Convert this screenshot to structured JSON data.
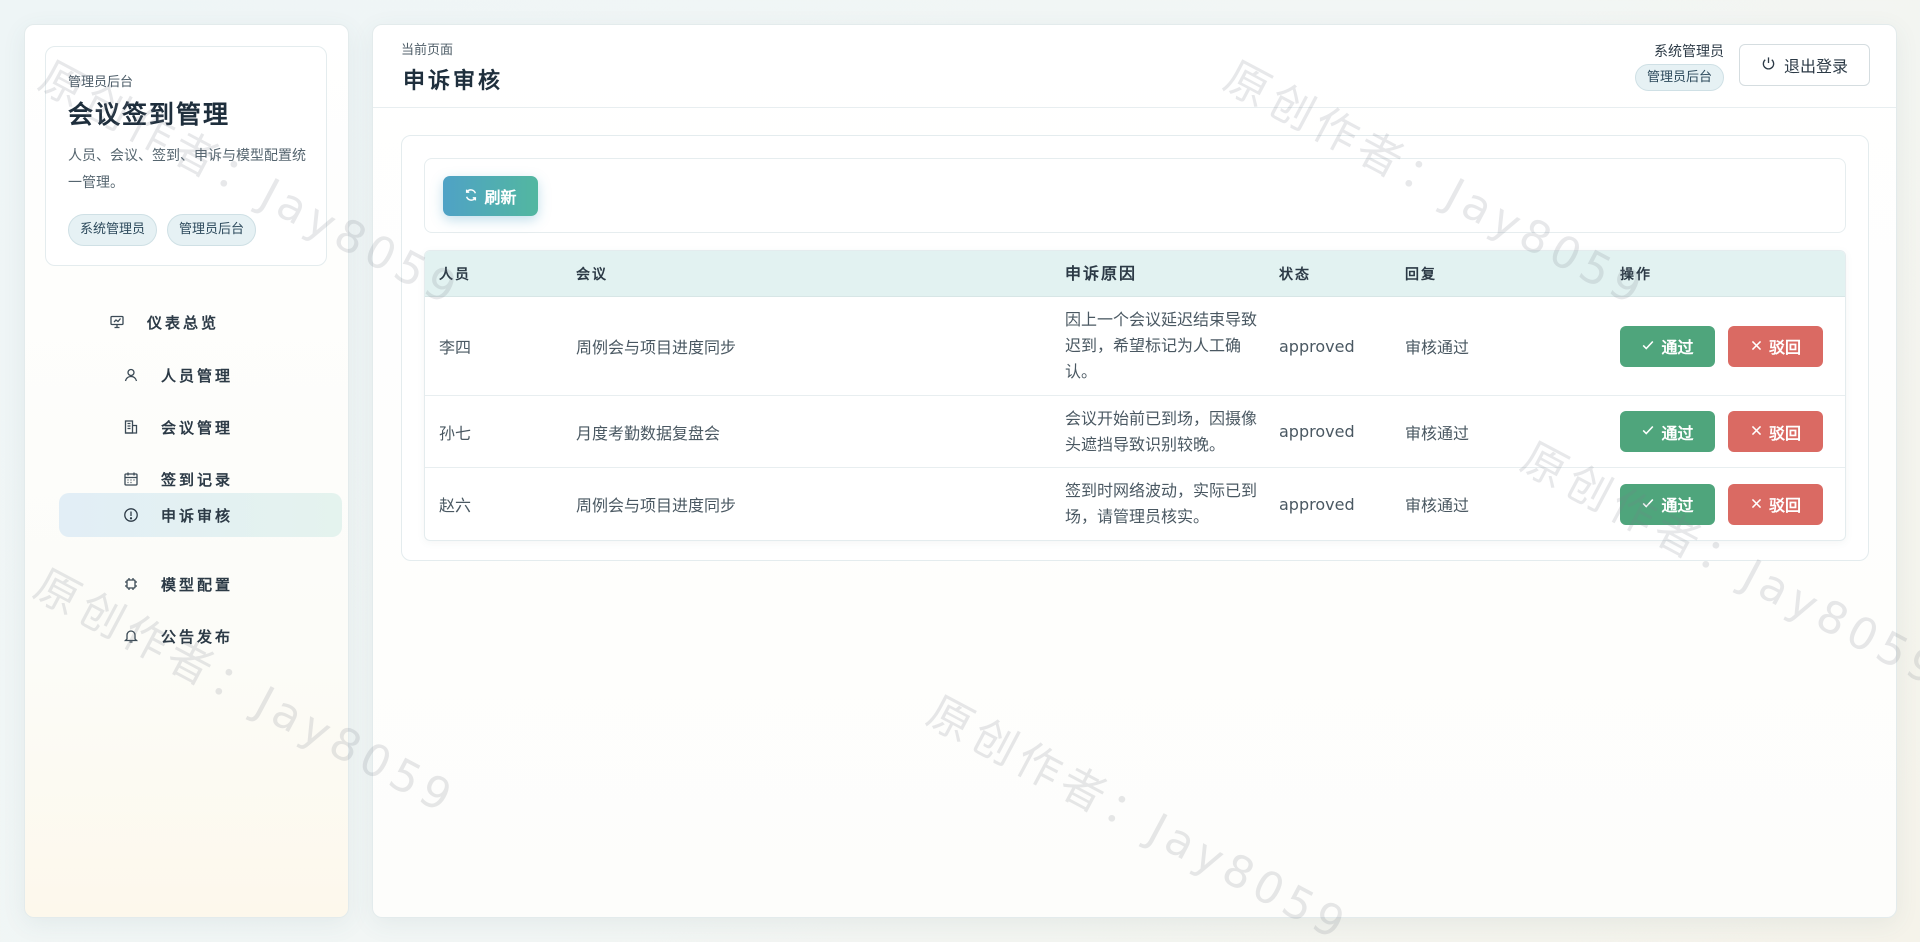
{
  "sidebar": {
    "brand_sub": "管理员后台",
    "brand_title": "会议签到管理",
    "brand_desc": "人员、会议、签到、申诉与模型配置统一管理。",
    "chips": [
      "系统管理员",
      "管理员后台"
    ],
    "items": [
      {
        "label": "仪表总览",
        "icon": "dashboard-icon"
      },
      {
        "label": "人员管理",
        "icon": "user-icon"
      },
      {
        "label": "会议管理",
        "icon": "building-icon"
      },
      {
        "label": "签到记录",
        "icon": "calendar-icon"
      },
      {
        "label": "申诉审核",
        "icon": "alert-circle-icon",
        "active": true
      },
      {
        "label": "模型配置",
        "icon": "chip-icon"
      },
      {
        "label": "公告发布",
        "icon": "bell-icon"
      }
    ]
  },
  "header": {
    "crumb": "当前页面",
    "title": "申诉审核",
    "user_name": "系统管理员",
    "user_role": "管理员后台",
    "logout_label": "退出登录"
  },
  "toolbar": {
    "refresh_label": "刷新"
  },
  "table": {
    "columns": [
      "人员",
      "会议",
      "申诉原因",
      "状态",
      "回复",
      "操作"
    ],
    "rows": [
      {
        "person": "李四",
        "meeting": "周例会与项目进度同步",
        "reason": "因上一个会议延迟结束导致迟到，希望标记为人工确认。",
        "status": "approved",
        "reply": "审核通过"
      },
      {
        "person": "孙七",
        "meeting": "月度考勤数据复盘会",
        "reason": "会议开始前已到场，因摄像头遮挡导致识别较晚。",
        "status": "approved",
        "reply": "审核通过"
      },
      {
        "person": "赵六",
        "meeting": "周例会与项目进度同步",
        "reason": "签到时网络波动，实际已到场，请管理员核实。",
        "status": "approved",
        "reply": "审核通过"
      }
    ],
    "approve_label": "通过",
    "reject_label": "驳回"
  },
  "watermark": "原创作者：Jay8059"
}
